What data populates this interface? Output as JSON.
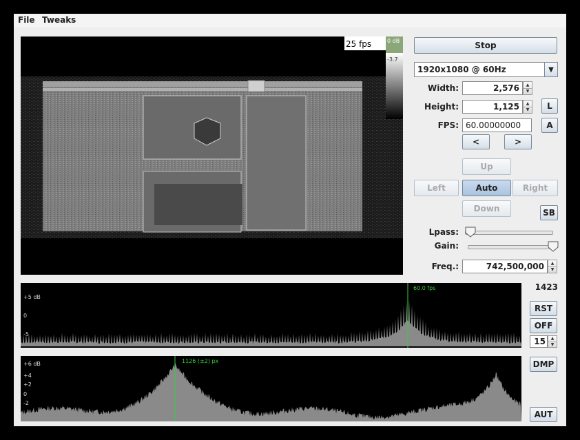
{
  "menu": {
    "file": "File",
    "tweaks": "Tweaks"
  },
  "preview": {
    "fps_readout": "25 fps",
    "db_top": "0 dB",
    "db_low": "-3.7"
  },
  "controls": {
    "stop_label": "Stop",
    "resolution": "1920x1080 @ 60Hz",
    "width_label": "Width:",
    "width_value": "2,576",
    "height_label": "Height:",
    "height_value": "1,125",
    "fps_label": "FPS:",
    "fps_value": "60.00000000",
    "prev_label": "<",
    "next_label": ">",
    "l_label": "L",
    "a_label": "A",
    "up_label": "Up",
    "left_label": "Left",
    "auto_label": "Auto",
    "right_label": "Right",
    "down_label": "Down",
    "sb_label": "SB",
    "lpass_label": "Lpass:",
    "gain_label": "Gain:",
    "freq_label": "Freq.:",
    "freq_value": "742,500,000",
    "lpass_level": 0.0,
    "gain_level": 1.0
  },
  "spectrum": {
    "count": "1423",
    "marker_label": "60.0 fps",
    "ticks": [
      "+5 dB",
      "0",
      "-5"
    ],
    "rst_label": "RST",
    "off_label": "OFF",
    "spin_value": "15"
  },
  "correlation": {
    "marker_label": "1126 (±2) px",
    "ticks": [
      "+6 dB",
      "+4",
      "+2",
      "0",
      "-2"
    ],
    "dmp_label": "DMP",
    "aut_label": "AUT"
  },
  "colors": {
    "accent_green": "#37d037",
    "plot_gray": "#8a8a8a",
    "window_bg": "#eeeeee"
  }
}
